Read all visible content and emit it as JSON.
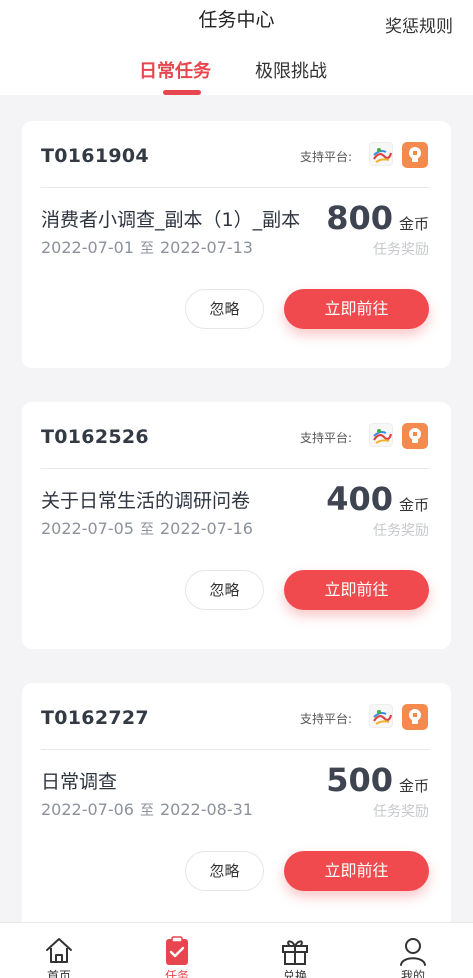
{
  "header": {
    "title": "任务中心",
    "rules_link": "奖惩规则",
    "tabs": [
      {
        "label": "日常任务",
        "active": true
      },
      {
        "label": "极限挑战",
        "active": false
      }
    ]
  },
  "tasks": [
    {
      "id": "T0161904",
      "platform_label": "支持平台:",
      "title": "消费者小调查_副本（1）_副本",
      "start_date": "2022-07-01",
      "date_separator": "至",
      "end_date": "2022-07-13",
      "reward_amount": "800",
      "reward_unit": "金币",
      "reward_label": "任务奖励",
      "ignore_label": "忽略",
      "go_label": "立即前往"
    },
    {
      "id": "T0162526",
      "platform_label": "支持平台:",
      "title": "关于日常生活的调研问卷",
      "start_date": "2022-07-05",
      "date_separator": "至",
      "end_date": "2022-07-16",
      "reward_amount": "400",
      "reward_unit": "金币",
      "reward_label": "任务奖励",
      "ignore_label": "忽略",
      "go_label": "立即前往"
    },
    {
      "id": "T0162727",
      "platform_label": "支持平台:",
      "title": "日常调查",
      "start_date": "2022-07-06",
      "date_separator": "至",
      "end_date": "2022-08-31",
      "reward_amount": "500",
      "reward_unit": "金币",
      "reward_label": "任务奖励",
      "ignore_label": "忽略",
      "go_label": "立即前往"
    }
  ],
  "bottom_nav": [
    {
      "label": "首页",
      "icon": "home-icon",
      "active": false
    },
    {
      "label": "任务",
      "icon": "task-clipboard-icon",
      "active": true
    },
    {
      "label": "兑换",
      "icon": "gift-icon",
      "active": false
    },
    {
      "label": "我的",
      "icon": "profile-icon",
      "active": false
    }
  ],
  "colors": {
    "accent": "#e8464e",
    "button": "#f0494e",
    "background": "#f4f4f6"
  }
}
